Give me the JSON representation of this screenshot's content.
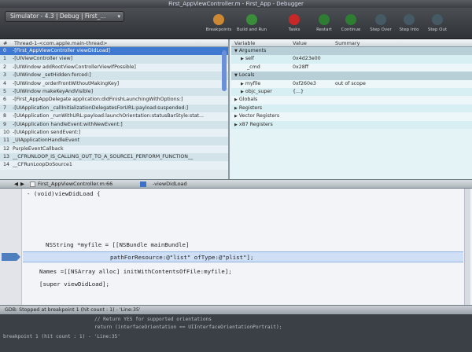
{
  "window": {
    "title": "First_AppViewController.m - First_App - Debugger"
  },
  "toolbar": {
    "scheme": "Simulator - 4.3 | Debug | First_...",
    "buttons": [
      {
        "label": "Breakpoints",
        "icon": "breakpoints-icon",
        "color": "#cc8833"
      },
      {
        "label": "Build and Run",
        "icon": "build-run-icon",
        "color": "#3a8e3a"
      },
      {
        "label": "Tasks",
        "icon": "stop-icon",
        "color": "#c62828"
      },
      {
        "label": "Restart",
        "icon": "restart-icon",
        "color": "#2e7d32"
      },
      {
        "label": "Continue",
        "icon": "continue-icon",
        "color": "#2e7d32"
      },
      {
        "label": "Step Over",
        "icon": "step-over-icon",
        "color": "#455a64"
      },
      {
        "label": "Step Into",
        "icon": "step-into-icon",
        "color": "#455a64"
      },
      {
        "label": "Step Out",
        "icon": "step-out-icon",
        "color": "#455a64"
      }
    ]
  },
  "threads": {
    "header": "Thread-1-<com.apple.main-thread>",
    "frames": [
      {
        "num": "0",
        "label": "-[First_AppViewController viewDidLoad]",
        "selected": true
      },
      {
        "num": "1",
        "label": "-[UIViewController view]"
      },
      {
        "num": "2",
        "label": "-[UIWindow addRootViewControllerViewIfPossible]"
      },
      {
        "num": "3",
        "label": "-[UIWindow _setHidden:forced:]"
      },
      {
        "num": "4",
        "label": "-[UIWindow _orderFrontWithoutMakingKey]"
      },
      {
        "num": "5",
        "label": "-[UIWindow makeKeyAndVisible]"
      },
      {
        "num": "6",
        "label": "-[First_AppAppDelegate application:didFinishLaunchingWithOptions:]"
      },
      {
        "num": "7",
        "label": "-[UIApplication _callInitializationDelegatesForURL:payload:suspended:]"
      },
      {
        "num": "8",
        "label": "-[UIApplication _runWithURL:payload:launchOrientation:statusBarStyle:stat..."
      },
      {
        "num": "9",
        "label": "-[UIApplication handleEvent:withNewEvent:]"
      },
      {
        "num": "10",
        "label": "-[UIApplication sendEvent:]"
      },
      {
        "num": "11",
        "label": "_UIApplicationHandleEvent"
      },
      {
        "num": "12",
        "label": "PurpleEventCallback"
      },
      {
        "num": "13",
        "label": "__CFRUNLOOP_IS_CALLING_OUT_TO_A_SOURCE1_PERFORM_FUNCTION__"
      },
      {
        "num": "14",
        "label": "__CFRunLoopDoSource1"
      }
    ]
  },
  "variables": {
    "columns": {
      "variable": "Variable",
      "value": "Value",
      "summary": "Summary"
    },
    "rows": [
      {
        "name": "Arguments",
        "value": "",
        "summary": "",
        "group": true,
        "indent": 0,
        "open": true
      },
      {
        "name": "self",
        "value": "0x4d23e00",
        "summary": "",
        "indent": 1,
        "open": false
      },
      {
        "name": "_cmd",
        "value": "0x28ff",
        "summary": "",
        "indent": 1,
        "leaf": true
      },
      {
        "name": "Locals",
        "value": "",
        "summary": "",
        "group": true,
        "indent": 0,
        "open": true
      },
      {
        "name": "myfile",
        "value": "0xf260e3",
        "summary": "out of scope",
        "indent": 1,
        "open": false
      },
      {
        "name": "objc_super",
        "value": "{...}",
        "summary": "",
        "indent": 1,
        "open": false
      },
      {
        "name": "Globals",
        "value": "",
        "summary": "",
        "indent": 0,
        "open": false
      },
      {
        "name": "Registers",
        "value": "",
        "summary": "",
        "indent": 0,
        "open": false
      },
      {
        "name": "Vector Registers",
        "value": "",
        "summary": "",
        "indent": 0,
        "open": false
      },
      {
        "name": "x87 Registers",
        "value": "",
        "summary": "",
        "indent": 0,
        "open": false
      }
    ]
  },
  "editor": {
    "file": "First_AppViewController.m:66",
    "symbol": "-viewDidLoad",
    "lines": [
      "- (void)viewDidLoad {",
      "NSString *myfile = [[NSBundle mainBundle]",
      "pathForResource:@\"list\" ofType:@\"plist\"];",
      "Names =[[NSArray alloc] initWithContentsOfFile:myfile];",
      "[super viewDidLoad];"
    ]
  },
  "status": {
    "text": "GDB: Stopped at breakpoint 1 (hit count : 1) - 'Line:35'"
  },
  "console": {
    "lines": [
      "// Return YES for supported orientations",
      "return (interfaceOrientation == UIInterfaceOrientationPortrait);",
      "breakpoint 1 (hit count : 1) - 'Line:35'"
    ]
  }
}
